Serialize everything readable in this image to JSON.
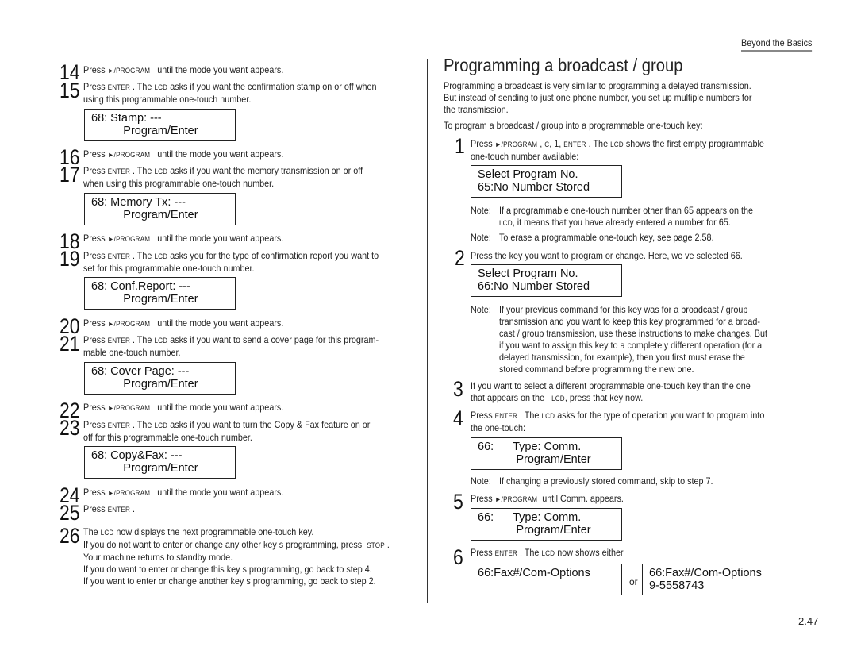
{
  "header": {
    "section": "Beyond the Basics"
  },
  "keys": {
    "program": "/PROGRAM",
    "enter": "ENTER",
    "lcd": "LCD",
    "stop": "STOP",
    "c": "C",
    "one": "1"
  },
  "left": {
    "steps": [
      {
        "num": "14",
        "pre": "Press",
        "key": "/PROGRAM",
        "post": "until the mode you want appears."
      },
      {
        "num": "15",
        "line1_pre": "Press",
        "line1_mid": ". The",
        "line1_post": "asks if you want the confirmation stamp on or off when",
        "line2": "using this programmable one-touch number."
      },
      {
        "num": "16",
        "pre": "Press",
        "key": "/PROGRAM",
        "post": "until the mode you want appears."
      },
      {
        "num": "17",
        "line1_pre": "Press",
        "line1_mid": ". The",
        "line1_post": "asks if you want the memory transmission on or off",
        "line2": "when using this programmable one-touch number."
      },
      {
        "num": "18",
        "pre": "Press",
        "key": "/PROGRAM",
        "post": "until the mode you want appears."
      },
      {
        "num": "19",
        "line1_pre": "Press",
        "line1_mid": ". The",
        "line1_post": "asks you for the type of confirmation report you want to",
        "line2": "set for this programmable one-touch number."
      },
      {
        "num": "20",
        "pre": "Press",
        "key": "/PROGRAM",
        "post": "until the mode you want appears."
      },
      {
        "num": "21",
        "line1_pre": "Press",
        "line1_mid": ". The",
        "line1_post": "asks if you want to send a cover page for this program-",
        "line2": "mable one-touch number."
      },
      {
        "num": "22",
        "pre": "Press",
        "key": "/PROGRAM",
        "post": "until the mode you want appears."
      },
      {
        "num": "23",
        "line1_pre": "Press",
        "line1_mid": ". The",
        "line1_post": "asks if you want to turn the Copy & Fax feature on or",
        "line2": "off for this programmable one-touch number."
      },
      {
        "num": "24",
        "pre": "Press",
        "key": "/PROGRAM",
        "post": "until the mode you want appears."
      },
      {
        "num": "25",
        "pre": "Press",
        "post": "."
      },
      {
        "num": "26",
        "line1_pre": "The",
        "line1_post": "now displays the next programmable one-touch key.",
        "line2_pre": "If you  do not want to enter or change   any other  key s programming, press",
        "line2_post": ".",
        "line3": "Your machine returns to standby mode.",
        "line4": "If you  do want to enter or change this key s programming, go back to step 4.",
        "line5": "If you want to enter or change    another  key s programming, go back to step 2."
      }
    ],
    "lcds": [
      {
        "line1": "68: Stamp: ---",
        "line2": "          Program/Enter"
      },
      {
        "line1": "68: Memory Tx: ---",
        "line2": "          Program/Enter"
      },
      {
        "line1": "68: Conf.Report: ---",
        "line2": "          Program/Enter"
      },
      {
        "line1": "68: Cover Page: ---",
        "line2": "          Program/Enter"
      },
      {
        "line1": "68: Copy&Fax: ---",
        "line2": "          Program/Enter"
      }
    ]
  },
  "right": {
    "title": "Programming a broadcast / group",
    "intro": [
      "Programming a broadcast is very similar to programming a delayed transmission.",
      "But instead of sending to just one phone number, you set up multiple numbers for",
      "the transmission."
    ],
    "lead": "To program a broadcast / group into a programmable one-touch key:",
    "step1": {
      "num": "1",
      "pre": "Press",
      "mid": ",",
      "post": ". The",
      "post2": "shows the first empty programmable",
      "line2": "one-touch number available:"
    },
    "lcd1": {
      "line1": "Select Program No.",
      "line2": "65:No Number Stored"
    },
    "note1": {
      "label": "Note:",
      "line1": "If a programmable one-touch number other than     65 appears on the",
      "line2_post": ", it means that you have already entered a number for     65."
    },
    "note2": {
      "label": "Note:",
      "line1": "To erase a programmable one-touch key, see page 2.58."
    },
    "step2": {
      "num": "2",
      "text": "Press the key you want to program or change. Here, we ve selected    66."
    },
    "lcd2": {
      "line1": "Select Program No.",
      "line2": "66:No Number Stored"
    },
    "note3": {
      "label": "Note:",
      "lines": [
        "If your previous command for this key was for a broadcast / group",
        "transmission and you want to keep this key programmed for a broad-",
        "cast / group transmission, use these instructions to make changes. But",
        "if you want to assign this key to a completely different operation (for a",
        "delayed transmission, for example), then you first must erase the",
        "stored command before programming the new one."
      ]
    },
    "step3": {
      "num": "3",
      "line1": "If you want to select a different programmable one-touch key than the one",
      "line2_pre": "that appears on the ",
      "line2_post": ", press that key now."
    },
    "step4": {
      "num": "4",
      "pre": "Press",
      "mid": ". The",
      "post": "asks for the type of operation you want to program into",
      "line2": "the one-touch:"
    },
    "lcd3": {
      "line1": "66:      Type: Comm.",
      "line2": "            Program/Enter"
    },
    "note4": {
      "label": "Note:",
      "line1": "If changing a previously stored command, skip to step 7."
    },
    "step5": {
      "num": "5",
      "pre": "Press",
      "post": "until    Comm.  appears."
    },
    "lcd4": {
      "line1": "66:      Type: Comm.",
      "line2": "            Program/Enter"
    },
    "step6": {
      "num": "6",
      "pre": "Press",
      "mid": ". The",
      "post": "now shows either"
    },
    "lcd5": {
      "line1": "66:Fax#/Com-Options",
      "line2": "_"
    },
    "or": "or",
    "lcd6": {
      "line1": "66:Fax#/Com-Options",
      "line2": "9-5558743_"
    }
  },
  "footer": {
    "page": "2.47"
  }
}
